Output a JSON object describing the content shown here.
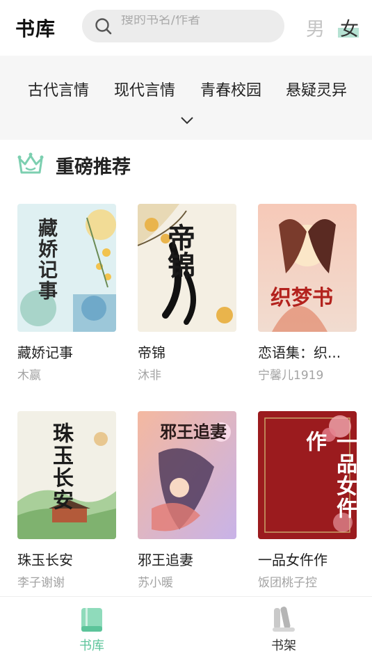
{
  "header": {
    "title": "书库",
    "search_placeholder": "搜的书名/作者",
    "gender_male": "男",
    "gender_female": "女"
  },
  "categories": [
    "古代言情",
    "现代言情",
    "青春校园",
    "悬疑灵异"
  ],
  "section": {
    "title": "重磅推荐"
  },
  "books": [
    {
      "title": "藏娇记事",
      "author": "木嬴",
      "cover_text": "藏娇记事"
    },
    {
      "title": "帝锦",
      "author": "沐非",
      "cover_text": "帝锦"
    },
    {
      "title": "恋语集：织...",
      "author": "宁馨儿1919",
      "cover_text": "织梦书"
    },
    {
      "title": "珠玉长安",
      "author": "李子谢谢",
      "cover_text": "珠玉长安"
    },
    {
      "title": "邪王追妻",
      "author": "苏小暖",
      "cover_text": "邪王追妻"
    },
    {
      "title": "一品女仵作",
      "author": "饭团桃子控",
      "cover_text": "一品女仵作"
    }
  ],
  "bottom_nav": [
    {
      "label": "书库",
      "active": true,
      "icon": "book-icon"
    },
    {
      "label": "书架",
      "active": false,
      "icon": "bookshelf-icon"
    }
  ],
  "colors": {
    "accent": "#5cc49a",
    "active_label": "#5cc49a",
    "inactive_label": "#333333"
  }
}
